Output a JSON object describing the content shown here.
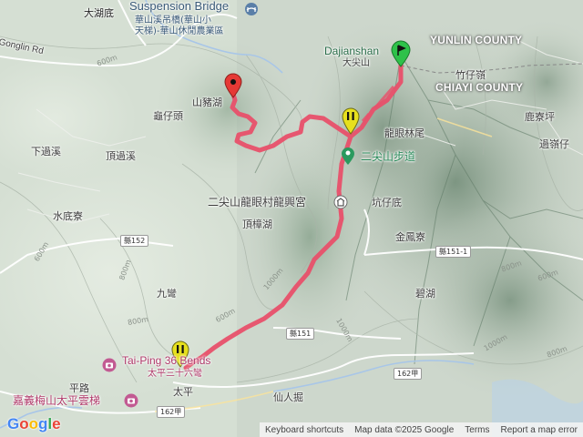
{
  "map": {
    "labels": [
      {
        "id": "dahudi",
        "text": "大湖底"
      },
      {
        "id": "bridge_en",
        "text": "Suspension Bridge"
      },
      {
        "id": "bridge_zh",
        "text": "華山溪吊橋(華山小"
      },
      {
        "id": "bridge_zh2",
        "text": "天梯)-華山休閒農業區"
      },
      {
        "id": "gonglin",
        "text": "Gonglin Rd"
      },
      {
        "id": "dajianshan_en",
        "text": "Dajianshan"
      },
      {
        "id": "dajianshan_zh",
        "text": "大尖山"
      },
      {
        "id": "yunlin",
        "text": "YUNLIN COUNTY"
      },
      {
        "id": "zhuzailing",
        "text": "竹仔嶺"
      },
      {
        "id": "chiayi",
        "text": "CHIAYI COUNTY"
      },
      {
        "id": "shanzhuhu",
        "text": "山豬湖"
      },
      {
        "id": "guizaitou",
        "text": "龜仔頭"
      },
      {
        "id": "luliaoping",
        "text": "鹿寮坪"
      },
      {
        "id": "longyanlinwei",
        "text": "龍眼林尾"
      },
      {
        "id": "guolingzai",
        "text": "過嶺仔"
      },
      {
        "id": "xiaguoxi",
        "text": "下過溪"
      },
      {
        "id": "dingguoxi",
        "text": "頂過溪"
      },
      {
        "id": "erjianshan_trail",
        "text": "二尖山步道"
      },
      {
        "id": "temple",
        "text": "二尖山龍眼村龍興宮"
      },
      {
        "id": "kengzaidi",
        "text": "坑仔底"
      },
      {
        "id": "shuidiliao",
        "text": "水底寮"
      },
      {
        "id": "dingzhanghu",
        "text": "頂樟湖"
      },
      {
        "id": "jinfengliao",
        "text": "金鳳寮"
      },
      {
        "id": "jiuwan",
        "text": "九彎"
      },
      {
        "id": "bihu",
        "text": "碧湖"
      },
      {
        "id": "taiping_en",
        "text": "Tai-Ping 36 Bends"
      },
      {
        "id": "taiping_zh",
        "text": "太平三十六彎"
      },
      {
        "id": "pinglu",
        "text": "平路"
      },
      {
        "id": "skywalk",
        "text": "嘉義梅山太平雲梯"
      },
      {
        "id": "taiping",
        "text": "太平"
      },
      {
        "id": "xianrenjue",
        "text": "仙人掘"
      }
    ],
    "contour_labels": [
      "600m",
      "600m",
      "800m",
      "800m",
      "600m",
      "1000m",
      "1000m",
      "800m",
      "600m",
      "1000m",
      "800m"
    ],
    "road_shields": [
      "縣152",
      "縣151-1",
      "縣151",
      "162甲",
      "162甲",
      "縣151"
    ],
    "route_color": "#e8506a",
    "markers": [
      {
        "name": "start",
        "color": "#2ec24a",
        "icon": "flag-icon"
      },
      {
        "name": "end",
        "color": "#e53935",
        "icon": "pin-icon"
      },
      {
        "name": "waypoint-1",
        "color": "#e6e01e",
        "icon": "pause-icon"
      },
      {
        "name": "waypoint-2",
        "color": "#e6e01e",
        "icon": "pause-icon"
      }
    ]
  },
  "footer": {
    "google": [
      "G",
      "o",
      "o",
      "g",
      "l",
      "e"
    ],
    "keyboard": "Keyboard shortcuts",
    "mapdata": "Map data ©2025 Google",
    "terms": "Terms",
    "report": "Report a map error"
  }
}
